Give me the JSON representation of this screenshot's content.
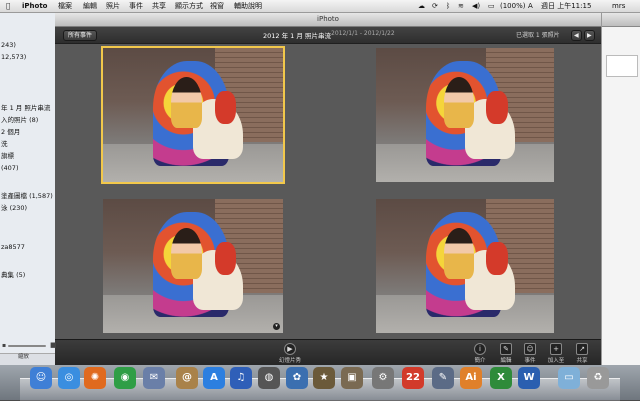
{
  "menubar": {
    "app_name": "iPhoto",
    "menus": [
      "檔案",
      "編輯",
      "照片",
      "事件",
      "共享",
      "顯示方式",
      "視窗",
      "輔助說明"
    ],
    "battery": "(100%)",
    "clock": "週日 上午11:15",
    "user": "mrs"
  },
  "window": {
    "title": "iPhoto",
    "toolbar": {
      "all_events_button": "所有事件",
      "event_title": "2012 年 1 月 照片串流",
      "date_range": "2012/1/1 - 2012/1/22",
      "selection_count": "已選取 1 張照片"
    },
    "bottombar": {
      "zoom_label": "縮放",
      "slideshow_label": "幻燈片秀",
      "info_label": "簡介",
      "edit_label": "編輯",
      "event_label": "事件",
      "add_to_label": "加入至",
      "share_label": "共享"
    }
  },
  "sidebar": {
    "rows": [
      {
        "text": "243)"
      },
      {
        "text": "12,573)"
      },
      {
        "text": "年 1 月 照片串流"
      },
      {
        "text": "入的照片 (8)"
      },
      {
        "text": "2 個月"
      },
      {
        "text": "洗"
      },
      {
        "text": "旗標"
      },
      {
        "text": "(407)"
      },
      {
        "text": "塗產圖檔 (1,587)"
      },
      {
        "text": "泳 (230)"
      },
      {
        "text": "za8577"
      },
      {
        "text": "典集 (5)"
      }
    ]
  },
  "dock": {
    "items": [
      {
        "name": "finder-icon",
        "glyph": "☺",
        "color": "#3f7fd6"
      },
      {
        "name": "safari-icon",
        "glyph": "◎",
        "color": "#3a8ee0"
      },
      {
        "name": "firefox-icon",
        "glyph": "✺",
        "color": "#e06a1e"
      },
      {
        "name": "chrome-icon",
        "glyph": "◉",
        "color": "#2f9e46"
      },
      {
        "name": "mail-icon",
        "glyph": "✉",
        "color": "#6a7fa8"
      },
      {
        "name": "address-book-icon",
        "glyph": "@",
        "color": "#a9824a"
      },
      {
        "name": "app-store-icon",
        "glyph": "A",
        "color": "#2c7fe0"
      },
      {
        "name": "itunes-icon",
        "glyph": "♫",
        "color": "#2f5fb8"
      },
      {
        "name": "camera-icon",
        "glyph": "◍",
        "color": "#555"
      },
      {
        "name": "iphoto-icon",
        "glyph": "✿",
        "color": "#3b6fb0"
      },
      {
        "name": "imovie-icon",
        "glyph": "★",
        "color": "#6b5a3a"
      },
      {
        "name": "preview-icon",
        "glyph": "▣",
        "color": "#7a6a52"
      },
      {
        "name": "system-preferences-icon",
        "glyph": "⚙",
        "color": "#777"
      },
      {
        "name": "calendar-icon",
        "glyph": "22",
        "color": "#d23a2a"
      },
      {
        "name": "utility-icon",
        "glyph": "✎",
        "color": "#5b6b86"
      },
      {
        "name": "illustrator-icon",
        "glyph": "Ai",
        "color": "#e0802a"
      },
      {
        "name": "excel-icon",
        "glyph": "X",
        "color": "#2e8b3a"
      },
      {
        "name": "word-icon",
        "glyph": "W",
        "color": "#2a5fb0"
      },
      {
        "name": "folder-icon",
        "glyph": "▭",
        "color": "#7fb0d8"
      },
      {
        "name": "trash-icon",
        "glyph": "♻",
        "color": "#999"
      }
    ]
  }
}
